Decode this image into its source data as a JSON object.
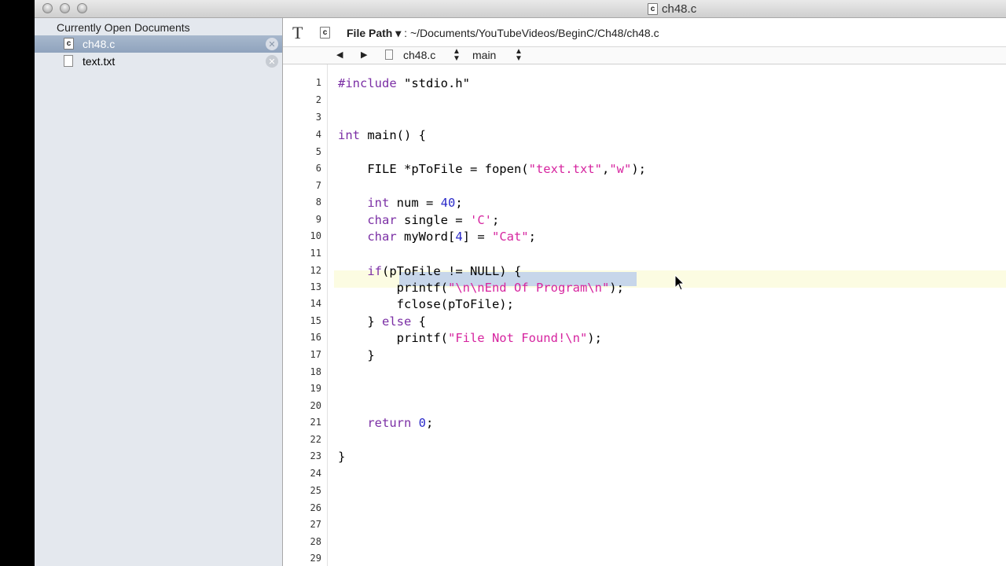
{
  "window": {
    "title": "ch48.c"
  },
  "sidebar": {
    "header": "Currently Open Documents",
    "documents": [
      {
        "name": "ch48.c",
        "icon": "c-file-icon",
        "selected": true
      },
      {
        "name": "text.txt",
        "icon": "text-file-icon",
        "selected": false
      }
    ]
  },
  "toolbar": {
    "filepath_label": "File Path",
    "filepath_value": ": ~/Documents/YouTubeVideos/BeginC/Ch48/ch48.c"
  },
  "jumpbar": {
    "file": "ch48.c",
    "symbol": "main"
  },
  "editor": {
    "line_numbers": [
      "1",
      "2",
      "3",
      "4",
      "5",
      "6",
      "7",
      "8",
      "9",
      "10",
      "11",
      "12",
      "13",
      "14",
      "15",
      "16",
      "17",
      "18",
      "19",
      "20",
      "21",
      "22",
      "23",
      "24",
      "25",
      "26",
      "27",
      "28",
      "29"
    ],
    "lines": [
      "#include \"stdio.h\"",
      "",
      "",
      "int main() {",
      "",
      "    FILE *pToFile = fopen(\"text.txt\",\"w\");",
      "",
      "    int num = 40;",
      "    char single = 'C';",
      "    char myWord[4] = \"Cat\";",
      "",
      "    if(pToFile != NULL) {",
      "        printf(\"\\n\\nEnd Of Program\\n\");",
      "        fclose(pToFile);",
      "    } else {",
      "        printf(\"File Not Found!\\n\");",
      "    }",
      "",
      "",
      "",
      "    return 0;",
      "",
      "}",
      "",
      "",
      "",
      "",
      "",
      ""
    ],
    "highlighted_line": 13,
    "colors": {
      "keyword": "#7b2fa5",
      "string": "#d6249f",
      "number": "#2b2bc9",
      "selection": "#c7d6ea",
      "current_line": "#fcfce2"
    }
  }
}
